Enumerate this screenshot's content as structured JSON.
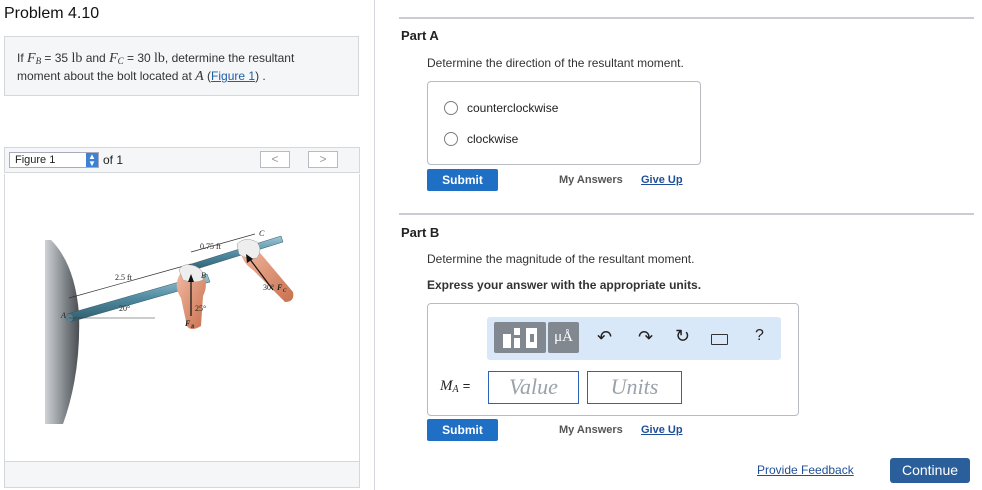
{
  "problem": {
    "title": "Problem 4.10",
    "statement": {
      "if": "If",
      "FB_sym": "F",
      "FB_sub": "B",
      "FB_eq": " = 35",
      "FB_unit": "lb",
      "and": "and",
      "FC_sym": "F",
      "FC_sub": "C",
      "FC_eq": " = 30",
      "FC_unit": "lb",
      "rest1": ", determine the resultant",
      "rest2": "moment about the bolt located at",
      "A_sym": "A",
      "fig_link": "Figure 1",
      "paren_open": "(",
      "paren_close": ") ."
    }
  },
  "figure_nav": {
    "select_value": "Figure 1",
    "of_text": "of 1",
    "prev": "<",
    "next": ">"
  },
  "figure": {
    "labels": {
      "dim1": "2.5 ft",
      "dim2": "0.75 ft",
      "angle1": "20°",
      "angle2": "25°",
      "angle3": "30°",
      "FB": "F",
      "FB_sub": "B",
      "FC": "F",
      "FC_sub": "C",
      "A": "A",
      "B": "B",
      "C": "C"
    }
  },
  "partA": {
    "label": "Part A",
    "question": "Determine the direction of the resultant moment.",
    "choices": [
      "counterclockwise",
      "clockwise"
    ],
    "submit": "Submit",
    "my_answers": "My Answers",
    "give_up": "Give Up"
  },
  "partB": {
    "label": "Part B",
    "question": "Determine the magnitude of the resultant moment.",
    "instruction": "Express your answer with the appropriate units.",
    "toolbar": {
      "mu_label": "μÅ",
      "help": "?"
    },
    "var_sym": "M",
    "var_sub": "A",
    "equals": "=",
    "value_placeholder": "Value",
    "units_placeholder": "Units",
    "submit": "Submit",
    "my_answers": "My Answers",
    "give_up": "Give Up"
  },
  "footer": {
    "feedback": "Provide Feedback",
    "continue": "Continue"
  },
  "colors": {
    "accent": "#1f6fc5",
    "toolbar_bg": "#d9e8f8",
    "continue_bg": "#2a5f9c",
    "link": "#1f4f96"
  }
}
